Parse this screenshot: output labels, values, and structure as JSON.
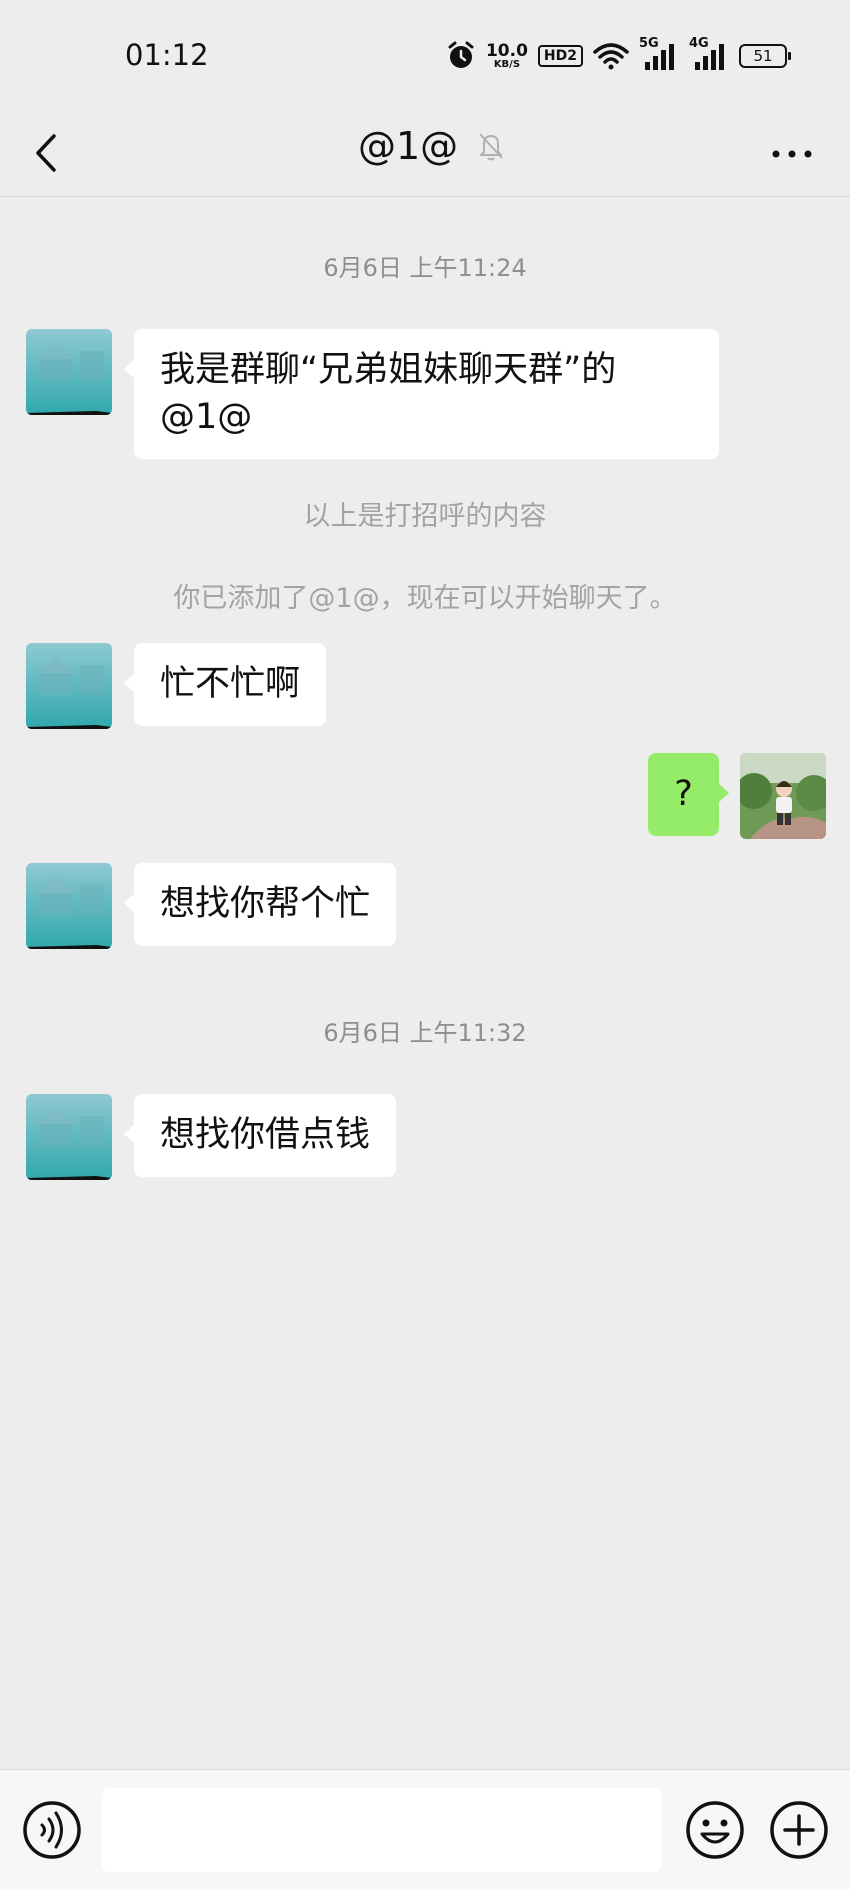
{
  "status_bar": {
    "time": "01:12",
    "net_speed_value": "10.0",
    "net_speed_unit": "KB/S",
    "hd_badge": "HD2",
    "signal1_label": "5G",
    "signal2_label": "4G",
    "battery": "51",
    "icons": [
      "alarm-icon",
      "hd-icon",
      "wifi-icon",
      "signal-5g-icon",
      "signal-4g-icon",
      "battery-icon"
    ]
  },
  "header": {
    "title": "@1@",
    "icons": [
      "back-arrow-icon",
      "mute-bell-icon",
      "more-dots-icon"
    ]
  },
  "chat": {
    "timestamp1": "6月6日 上午11:24",
    "msg1": "我是群聊“兄弟姐妹聊天群”的@1@",
    "system1": "以上是打招呼的内容",
    "system2": "你已添加了@1@，现在可以开始聊天了。",
    "msg2": "忙不忙啊",
    "msg3_self": "?",
    "msg4": "想找你帮个忙",
    "timestamp2": "6月6日 上午11:32",
    "msg5": "想找你借点钱"
  },
  "input_bar": {
    "placeholder": "",
    "icons": [
      "voice-icon",
      "emoji-icon",
      "plus-icon"
    ]
  },
  "colors": {
    "background": "#ededed",
    "self_bubble": "#95ec69",
    "other_bubble": "#ffffff",
    "timestamp_text": "#8e8e8e"
  }
}
